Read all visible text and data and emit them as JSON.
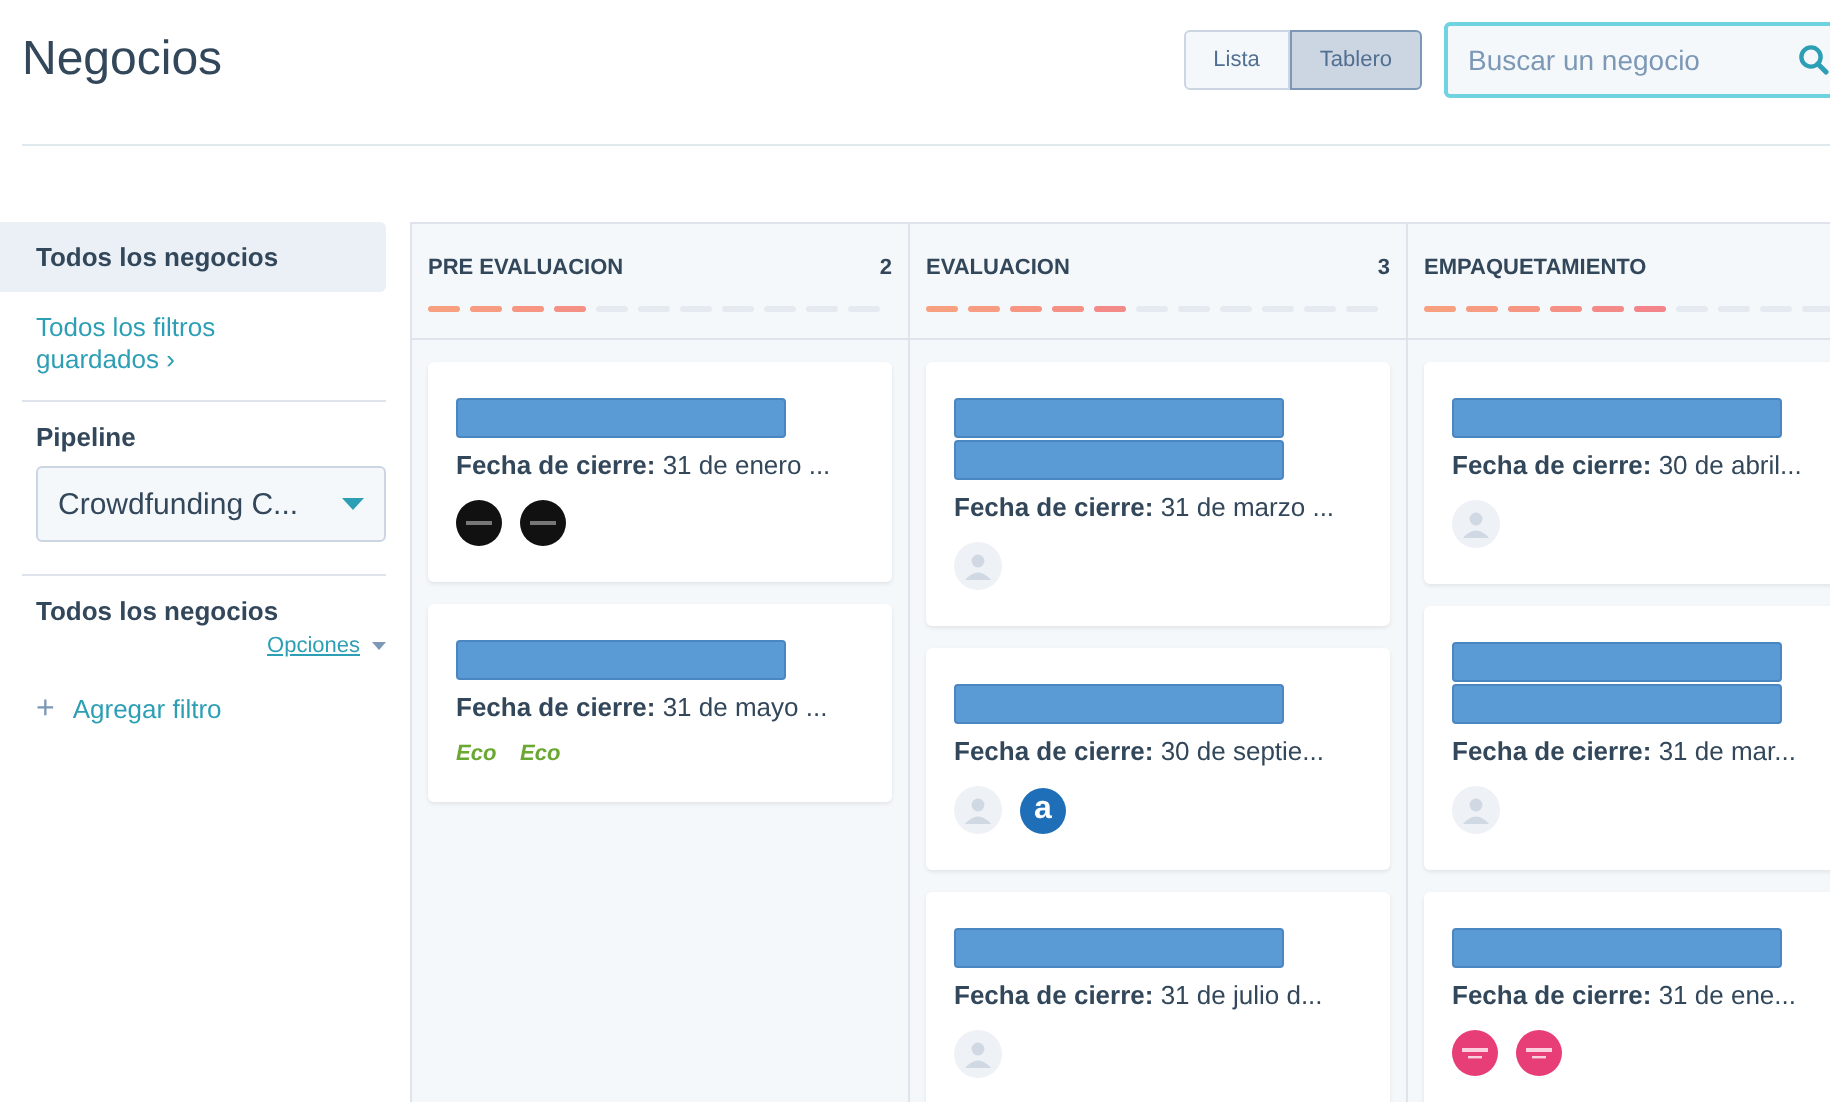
{
  "header": {
    "title": "Negocios",
    "view_toggle": [
      {
        "label": "Lista",
        "selected": false
      },
      {
        "label": "Tablero",
        "selected": true
      }
    ],
    "search": {
      "placeholder": "Buscar un negocio"
    }
  },
  "sidebar": {
    "items": [
      {
        "label": "Todos los negocios",
        "selected": true
      }
    ],
    "saved_filters_link": "Todos los filtros guardados",
    "saved_filters_chevron": "›",
    "pipeline_label": "Pipeline",
    "pipeline_value": "Crowdfunding C...",
    "filter_title": "Todos los negocios",
    "options_link": "Opciones",
    "add_filter_icon": "+",
    "add_filter": "Agregar filtro"
  },
  "board": {
    "columns": [
      {
        "name": "PRE EVALUACION",
        "count": "2",
        "level": 0.364,
        "cards": [
          {
            "name_lines": [
              {
                "kind": "redacted"
              }
            ],
            "close_date": "Fecha de cierre:",
            "date_value": " 31 de enero ...",
            "avatars": [
              {
                "kind": "dark-logo"
              },
              {
                "kind": "dark-logo"
              }
            ]
          },
          {
            "name_lines": [
              {
                "kind": "redacted"
              }
            ],
            "close_date": "Fecha de cierre:",
            "date_value": " 31 de mayo ...",
            "avatars": [
              {
                "kind": "eco-logo",
                "label": "Eco"
              },
              {
                "kind": "eco-logo",
                "label": "Eco"
              }
            ]
          }
        ]
      },
      {
        "name": "EVALUACION",
        "count": "3",
        "level": 0.455,
        "cards": [
          {
            "name_lines": [
              {
                "kind": "redacted"
              },
              {
                "kind": "redacted"
              }
            ],
            "close_date": "Fecha de cierre:",
            "date_value": " 31 de marzo ...",
            "avatars": [
              {
                "kind": "placeholder"
              }
            ]
          },
          {
            "name_lines": [
              {
                "kind": "redacted"
              }
            ],
            "close_date": "Fecha de cierre:",
            "date_value": " 30 de septie...",
            "avatars": [
              {
                "kind": "placeholder"
              },
              {
                "kind": "letter-logo",
                "label": "a"
              }
            ]
          },
          {
            "name_lines": [
              {
                "kind": "redacted"
              }
            ],
            "close_date": "Fecha de cierre:",
            "date_value": " 31 de julio d...",
            "avatars": [
              {
                "kind": "placeholder"
              }
            ]
          }
        ]
      },
      {
        "name": "EMPAQUETAMIENTO",
        "level": 0.545,
        "cards": [
          {
            "name_lines": [
              {
                "kind": "redacted"
              }
            ],
            "close_date": "Fecha de cierre:",
            "date_value": " 30 de abril...",
            "avatars": [
              {
                "kind": "placeholder"
              }
            ]
          },
          {
            "name_lines": [
              {
                "kind": "redacted"
              },
              {
                "kind": "redacted"
              }
            ],
            "close_date": "Fecha de cierre:",
            "date_value": " 31 de mar...",
            "avatars": [
              {
                "kind": "placeholder"
              }
            ]
          },
          {
            "name_lines": [
              {
                "kind": "redacted"
              }
            ],
            "close_date": "Fecha de cierre:",
            "date_value": " 31 de ene...",
            "avatars": [
              {
                "kind": "pink-logo"
              },
              {
                "kind": "pink-logo"
              }
            ]
          }
        ]
      }
    ]
  }
}
